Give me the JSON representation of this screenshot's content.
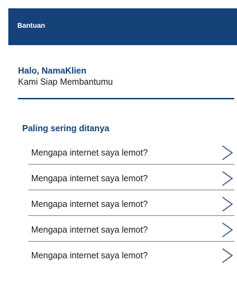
{
  "header": {
    "title": "Bantuan"
  },
  "greeting": {
    "name": "Halo, NamaKlien",
    "subtitle": "Kami Siap Membantumu"
  },
  "faq": {
    "title": "Paling sering ditanya",
    "items": [
      {
        "question": "Mengapa internet saya lemot?",
        "arrow_icon": "chevron-right-icon"
      },
      {
        "question": "Mengapa internet saya lemot?",
        "arrow_icon": "chevron-right-icon"
      },
      {
        "question": "Mengapa internet saya lemot?",
        "arrow_icon": "chevron-right-icon"
      },
      {
        "question": "Mengapa internet saya lemot?",
        "arrow_icon": "chevron-right-icon"
      },
      {
        "question": "Mengapa internet saya lemot?",
        "arrow_icon": "chevron-right-icon"
      }
    ]
  },
  "colors": {
    "primary": "#16427a",
    "text": "#1b1b1b",
    "divider": "#8c8c8c",
    "arrow": "#4a5d8a"
  }
}
